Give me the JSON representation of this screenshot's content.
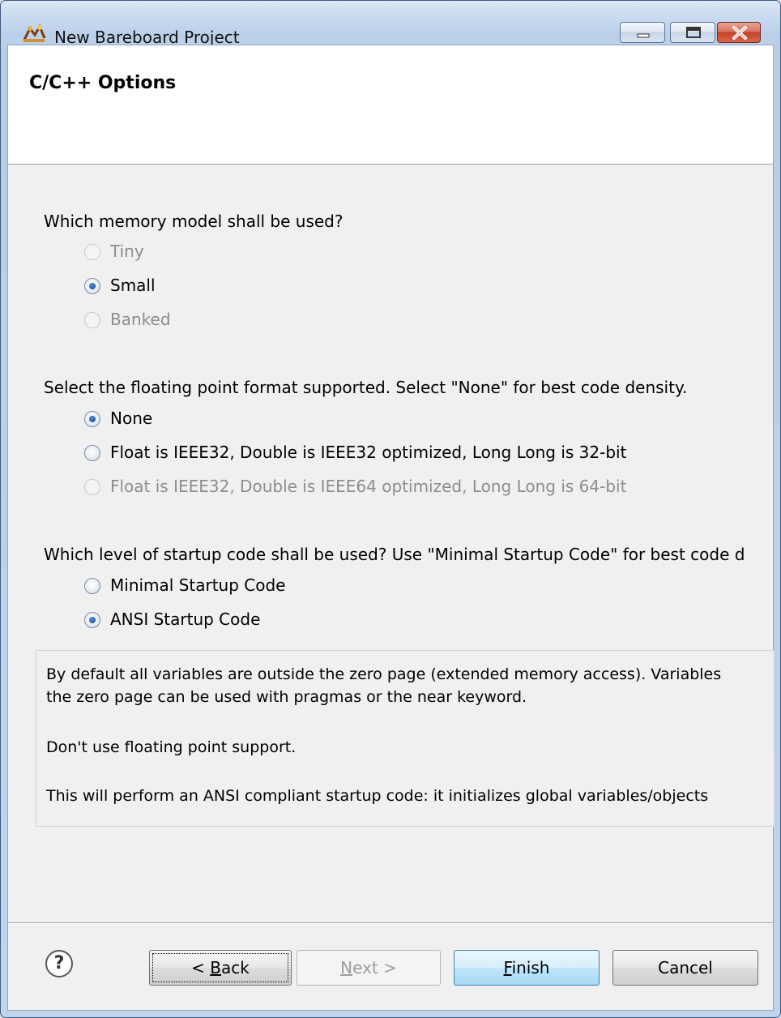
{
  "window": {
    "title": "New Bareboard Project",
    "controls": [
      "minimize",
      "maximize",
      "close"
    ]
  },
  "page": {
    "title": "C/C++ Options"
  },
  "memory_model": {
    "question": "Which memory model shall be used?",
    "options": [
      {
        "label": "Tiny",
        "checked": false,
        "enabled": false
      },
      {
        "label": "Small",
        "checked": true,
        "enabled": true
      },
      {
        "label": "Banked",
        "checked": false,
        "enabled": false
      }
    ]
  },
  "floating_point": {
    "question": "Select the floating point format supported. Select \"None\" for best code density.",
    "options": [
      {
        "label": "None",
        "checked": true,
        "enabled": true
      },
      {
        "label": "Float is IEEE32, Double is IEEE32 optimized, Long Long is 32-bit",
        "checked": false,
        "enabled": true
      },
      {
        "label": "Float is IEEE32, Double is IEEE64 optimized, Long Long is 64-bit",
        "checked": false,
        "enabled": false
      }
    ]
  },
  "startup_code": {
    "question": "Which level of startup code shall be used? Use \"Minimal Startup Code\" for best code d",
    "options": [
      {
        "label": "Minimal Startup Code",
        "checked": false,
        "enabled": true
      },
      {
        "label": "ANSI Startup Code",
        "checked": true,
        "enabled": true
      }
    ]
  },
  "info": {
    "line1": "By default all variables are outside the zero page (extended memory access). Variables",
    "line2": "the zero page can be used with pragmas or the near keyword.",
    "line3": "Don't use floating point support.",
    "line4": "This will perform an ANSI compliant startup code: it initializes global variables/objects"
  },
  "buttons": {
    "back_mnemonic": "< ",
    "back_key": "B",
    "back_rest": "ack",
    "next_key": "N",
    "next_rest": "ext >",
    "finish_key": "F",
    "finish_rest": "inish",
    "cancel": "Cancel",
    "help_glyph": "?"
  }
}
